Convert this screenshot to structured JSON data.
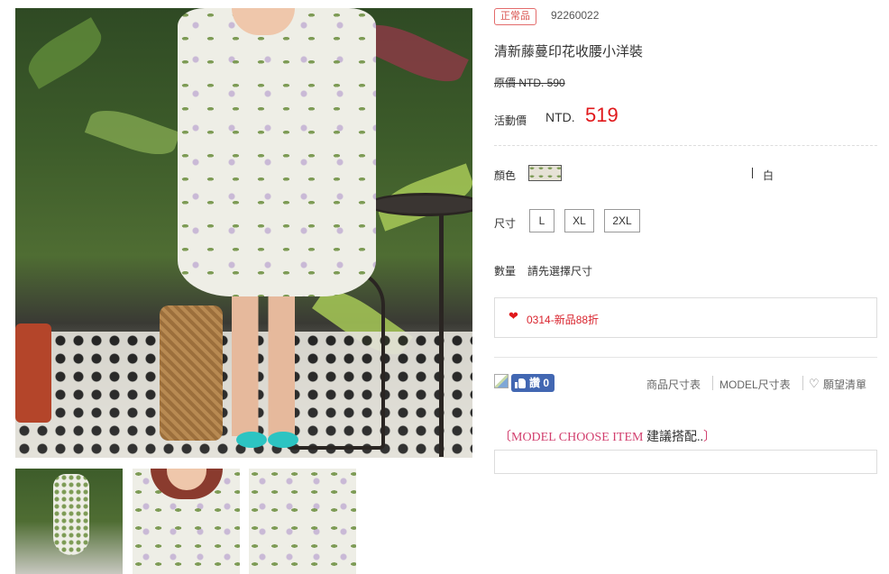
{
  "gallery": {
    "main_image_alt": "main product photo",
    "thumbnails": [
      "thumbnail-1",
      "thumbnail-2",
      "thumbnail-3"
    ]
  },
  "product": {
    "badge": "正常品",
    "sku": "92260022",
    "title": "清新藤蔓印花收腰小洋裝",
    "original_price": "原價 NTD. 590",
    "sale_label": "活動價",
    "sale_currency": "NTD.",
    "sale_amount": "519"
  },
  "options": {
    "color_label": "顏色",
    "color_name": "白",
    "size_label": "尺寸",
    "sizes": [
      "L",
      "XL",
      "2XL"
    ],
    "quantity_label": "數量",
    "quantity_value": "請先選擇尺寸"
  },
  "promo": {
    "text": "0314-新品88折"
  },
  "social": {
    "like_label": "讚 0"
  },
  "links": {
    "size_chart": "商品尺寸表",
    "model_size_chart": "MODEL尺寸表",
    "wishlist": "願望清單"
  },
  "model_section": {
    "open": "〔",
    "heading_en": "MODEL CHOOSE ITEM",
    "heading_zh": " 建議搭配..",
    "close": "〕"
  },
  "colors": {
    "sale_price": "#e0181b",
    "badge": "#d9534f",
    "facebook": "#4267b2",
    "model_heading": "#d23f6e"
  }
}
